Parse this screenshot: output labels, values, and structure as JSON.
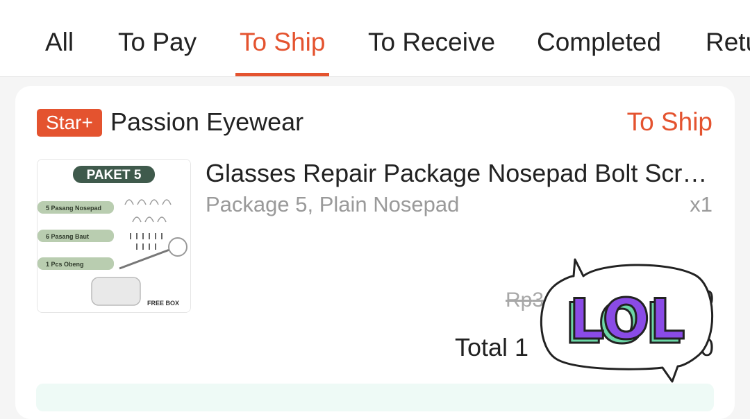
{
  "tabs": [
    {
      "label": "All"
    },
    {
      "label": "To Pay"
    },
    {
      "label": "To Ship"
    },
    {
      "label": "To Receive"
    },
    {
      "label": "Completed"
    },
    {
      "label": "Retu"
    }
  ],
  "active_tab": "To Ship",
  "order": {
    "badge": "Star+",
    "shop_name": "Passion Eyewear",
    "status": "To Ship",
    "product": {
      "title": "Glasses Repair Package Nosepad Bolt Scre…",
      "variant": "Package 5, Plain Nosepad",
      "quantity": "x1",
      "price_partial": "Rp",
      "price_partial_digit": "3",
      "price_tail": "0",
      "thumbnail": {
        "header": "PAKET 5",
        "labels": [
          "5 Pasang Nosepad",
          "6 Pasang Baut",
          "1 Pcs Obeng"
        ],
        "footer": "FREE BOX"
      }
    },
    "total_partial": "Total 1",
    "total_tail": "0"
  },
  "sticker": {
    "text": "LOL"
  },
  "colors": {
    "accent": "#e4532f",
    "sticker_fill": "#8a4be6",
    "sticker_shadow": "#6cd6a6"
  }
}
